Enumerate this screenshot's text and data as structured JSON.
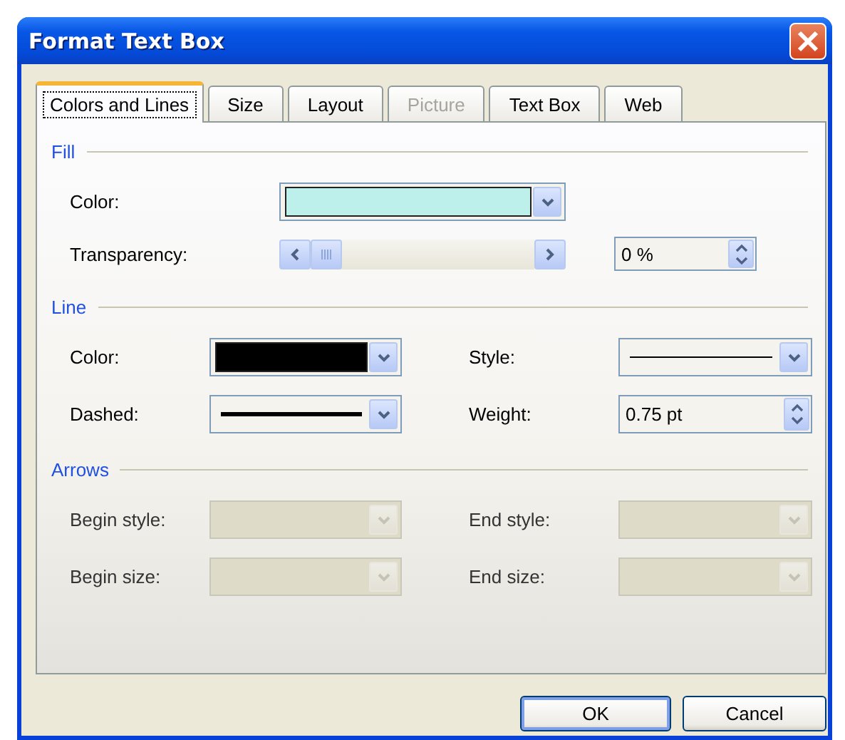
{
  "window": {
    "title": "Format Text Box"
  },
  "tabs": [
    {
      "label": "Colors and Lines",
      "selected": true,
      "disabled": false
    },
    {
      "label": "Size",
      "selected": false,
      "disabled": false
    },
    {
      "label": "Layout",
      "selected": false,
      "disabled": false
    },
    {
      "label": "Picture",
      "selected": false,
      "disabled": true
    },
    {
      "label": "Text Box",
      "selected": false,
      "disabled": false
    },
    {
      "label": "Web",
      "selected": false,
      "disabled": false
    }
  ],
  "sections": [
    {
      "title": "Fill",
      "kind": "wide",
      "fields": [
        {
          "label": "Color:",
          "kind": "color",
          "color": "#bdf0ea",
          "disabled": false
        },
        {
          "label": "Transparency:",
          "kind": "slider",
          "level": 0,
          "value": "0 %"
        }
      ]
    },
    {
      "title": "Line",
      "kind": "pairs",
      "fields": [
        {
          "label": "Color:",
          "kind": "color",
          "color": "#000000",
          "disabled": false
        },
        {
          "label": "Style:",
          "kind": "thin",
          "disabled": false
        },
        {
          "label": "Dashed:",
          "kind": "thick",
          "disabled": false
        },
        {
          "label": "Weight:",
          "kind": "spinner",
          "value": "0.75 pt"
        }
      ]
    },
    {
      "title": "Arrows",
      "kind": "pairs",
      "fields": [
        {
          "label": "Begin style:",
          "kind": "empty",
          "disabled": true
        },
        {
          "label": "End style:",
          "kind": "empty",
          "disabled": true
        },
        {
          "label": "Begin size:",
          "kind": "empty",
          "disabled": true
        },
        {
          "label": "End size:",
          "kind": "empty",
          "disabled": true
        }
      ]
    }
  ],
  "buttons": [
    {
      "label": "OK",
      "default": true
    },
    {
      "label": "Cancel",
      "default": false
    }
  ]
}
